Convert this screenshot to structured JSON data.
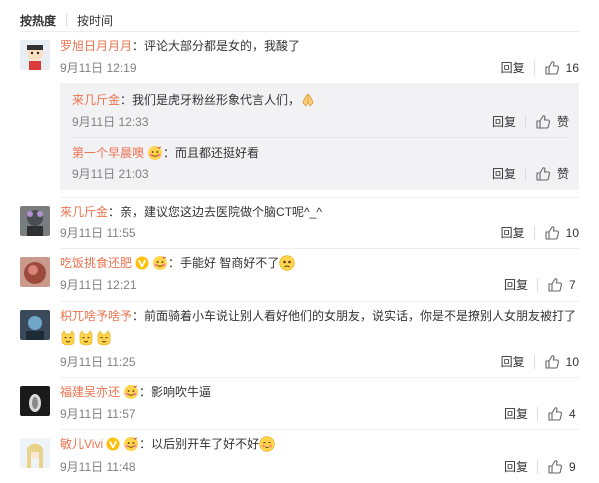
{
  "sort": {
    "hot_label": "按热度",
    "time_label": "按时间"
  },
  "comments": [
    {
      "user": "罗旭日月月月",
      "text": "评论大部分都是女的，我酸了",
      "time": "9月11日 12:19",
      "reply_label": "回复",
      "likes": "16"
    },
    {
      "user": "来几斤金",
      "text": "亲，建议您这边去医院做个脑CT呢^_^",
      "time": "9月11日 11:55",
      "reply_label": "回复",
      "likes": "10"
    },
    {
      "user": "吃饭挑食还肥",
      "text": "手能好 智商好不了",
      "time": "9月11日 12:21",
      "reply_label": "回复",
      "likes": "7"
    },
    {
      "user": "枳兀啥予啥予",
      "text": "前面骑着小车说让别人看好他们的女朋友，说实话，你是不是撩别人女朋友被打了",
      "time": "9月11日 11:25",
      "reply_label": "回复",
      "likes": "10"
    },
    {
      "user": "福建吴亦还",
      "text": "影响吹牛逼",
      "time": "9月11日 11:57",
      "reply_label": "回复",
      "likes": "4"
    },
    {
      "user": "敏儿Vivi",
      "text": "以后别开车了好不好",
      "time": "9月11日 11:48",
      "reply_label": "回复",
      "likes": "9"
    }
  ],
  "replies": [
    {
      "user": "来几斤金",
      "text": "我们是虎牙粉丝形象代言人们，",
      "time": "9月11日 12:33",
      "reply_label": "回复",
      "likes": "赞"
    },
    {
      "user": "第一个早晨噢",
      "text": "而且都还挺好看",
      "time": "9月11日 21:03",
      "reply_label": "回复",
      "likes": "赞"
    }
  ],
  "colors": {
    "username": "#eb7350",
    "meta": "#808080",
    "reply_bg": "#f2f2f5"
  },
  "icons": [
    "thumb-up-icon",
    "vip-v-icon",
    "fan-badge-icon",
    "pray-hands-emoji",
    "worried-face-emoji",
    "cat-face-emoji",
    "shy-face-emoji"
  ]
}
